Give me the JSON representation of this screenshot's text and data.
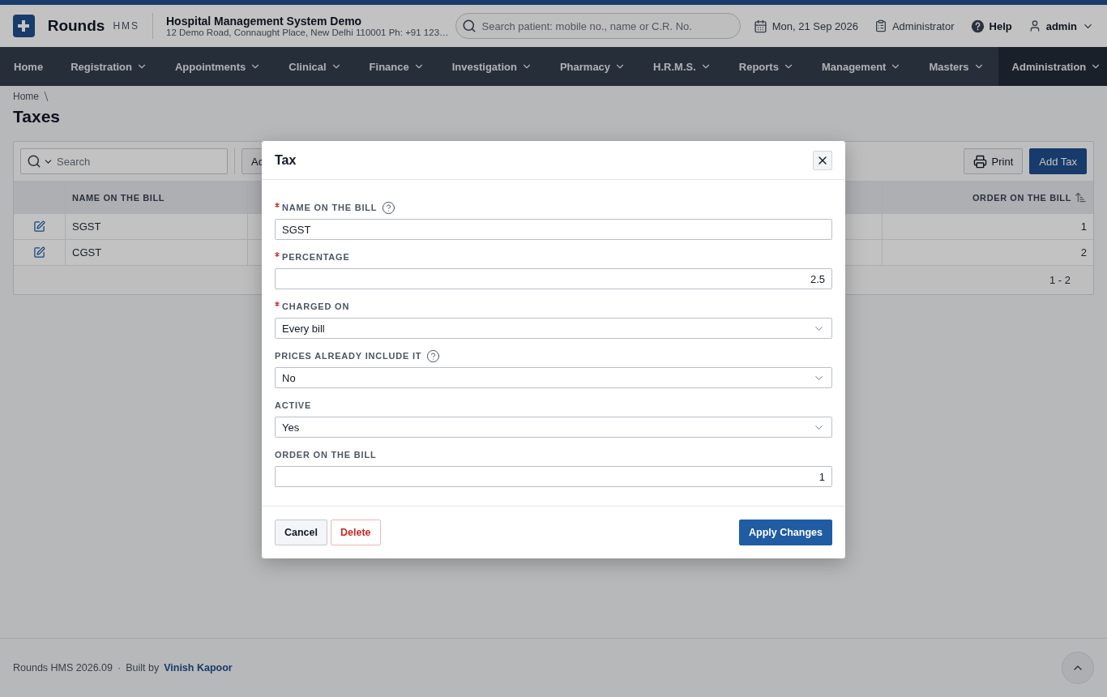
{
  "header": {
    "brand": "Rounds",
    "brand_suffix": "HMS",
    "org_name": "Hospital Management System Demo",
    "org_address": "12 Demo Road, Connaught Place, New Delhi 110001 Ph: +91 123…",
    "search": {
      "placeholder": "Search patient: mobile no., name or C.R. No."
    },
    "date": "Mon, 21 Sep 2026",
    "role": "Administrator",
    "help": "Help",
    "user": "admin"
  },
  "nav": [
    {
      "label": "Home",
      "dropdown": false,
      "selected": false
    },
    {
      "label": "Registration",
      "dropdown": true,
      "selected": false
    },
    {
      "label": "Appointments",
      "dropdown": true,
      "selected": false
    },
    {
      "label": "Clinical",
      "dropdown": true,
      "selected": false
    },
    {
      "label": "Finance",
      "dropdown": true,
      "selected": false
    },
    {
      "label": "Investigation",
      "dropdown": true,
      "selected": false
    },
    {
      "label": "Pharmacy",
      "dropdown": true,
      "selected": false
    },
    {
      "label": "H.R.M.S.",
      "dropdown": true,
      "selected": false
    },
    {
      "label": "Reports",
      "dropdown": true,
      "selected": false
    },
    {
      "label": "Management",
      "dropdown": true,
      "selected": false
    },
    {
      "label": "Masters",
      "dropdown": true,
      "selected": false
    },
    {
      "label": "Administration",
      "dropdown": true,
      "selected": true
    }
  ],
  "breadcrumb": [
    "Home"
  ],
  "page_title": "Taxes",
  "toolbar": {
    "search": {
      "placeholder": "Search"
    },
    "actions_button": "Ac",
    "print_button": "Print",
    "add_button": "Add Tax"
  },
  "table": {
    "columns": [
      "NAME ON THE BILL",
      "ORDER ON THE BILL"
    ],
    "rows": [
      {
        "name": "SGST",
        "order": "1"
      },
      {
        "name": "CGST",
        "order": "2"
      }
    ],
    "range": "1 - 2"
  },
  "dialog": {
    "title": "Tax",
    "fields": [
      {
        "label": "NAME ON THE BILL",
        "required": true,
        "help": true,
        "kind": "text",
        "value": "SGST"
      },
      {
        "label": "PERCENTAGE",
        "required": true,
        "help": false,
        "kind": "number",
        "value": "2.5"
      },
      {
        "label": "CHARGED ON",
        "required": true,
        "help": false,
        "kind": "select",
        "value": "Every bill"
      },
      {
        "label": "PRICES ALREADY INCLUDE IT",
        "required": false,
        "help": true,
        "kind": "select",
        "value": "No"
      },
      {
        "label": "ACTIVE",
        "required": false,
        "help": false,
        "kind": "select",
        "value": "Yes"
      },
      {
        "label": "ORDER ON THE BILL",
        "required": false,
        "help": false,
        "kind": "number",
        "value": "1"
      }
    ],
    "buttons": {
      "cancel": "Cancel",
      "delete": "Delete",
      "apply": "Apply Changes"
    }
  },
  "footer": {
    "version": "Rounds HMS 2026.09",
    "separator": "·",
    "built_by": "Built by",
    "author": "Vinish Kapoor"
  }
}
